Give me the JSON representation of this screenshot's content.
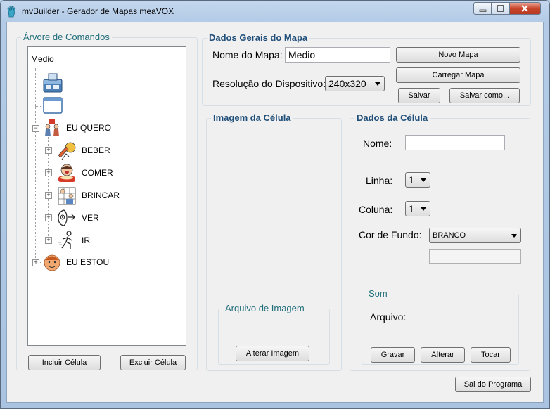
{
  "window": {
    "title": "mvBuilder - Gerador de Mapas meaVOX"
  },
  "tree_panel": {
    "legend": "Árvore de Comandos",
    "root": "Medio",
    "items": [
      {
        "label": "",
        "icon": "computer-card-icon"
      },
      {
        "label": "",
        "icon": "window-card-icon"
      },
      {
        "label": "EU QUERO",
        "icon": "person-want-icon"
      },
      {
        "label": "BEBER",
        "icon": "drink-icon"
      },
      {
        "label": "COMER",
        "icon": "eat-icon"
      },
      {
        "label": "BRINCAR",
        "icon": "play-icon"
      },
      {
        "label": "VER",
        "icon": "see-icon"
      },
      {
        "label": "IR",
        "icon": "walk-icon"
      },
      {
        "label": "EU ESTOU",
        "icon": "face-icon"
      }
    ],
    "include_button": "Incluir Célula",
    "exclude_button": "Excluir Célula"
  },
  "general": {
    "legend": "Dados Gerais do Mapa",
    "map_name_label": "Nome do Mapa:",
    "map_name_value": "Medio",
    "resolution_label": "Resolução do Dispositivo:",
    "resolution_value": "240x320",
    "new_map_button": "Novo Mapa",
    "load_map_button": "Carregar Mapa",
    "save_button": "Salvar",
    "save_as_button": "Salvar como..."
  },
  "image_panel": {
    "legend": "Imagem da Célula",
    "file_legend": "Arquivo de Imagem",
    "change_image_button": "Alterar Imagem"
  },
  "cell_panel": {
    "legend": "Dados da Célula",
    "name_label": "Nome:",
    "name_value": "",
    "row_label": "Linha:",
    "row_value": "1",
    "col_label": "Coluna:",
    "col_value": "1",
    "bg_label": "Cor de Fundo:",
    "bg_value": "BRANCO",
    "sound_legend": "Som",
    "file_label": "Arquivo:",
    "record_button": "Gravar",
    "change_button": "Alterar",
    "play_button": "Tocar"
  },
  "exit_button": "Sai do Programa"
}
